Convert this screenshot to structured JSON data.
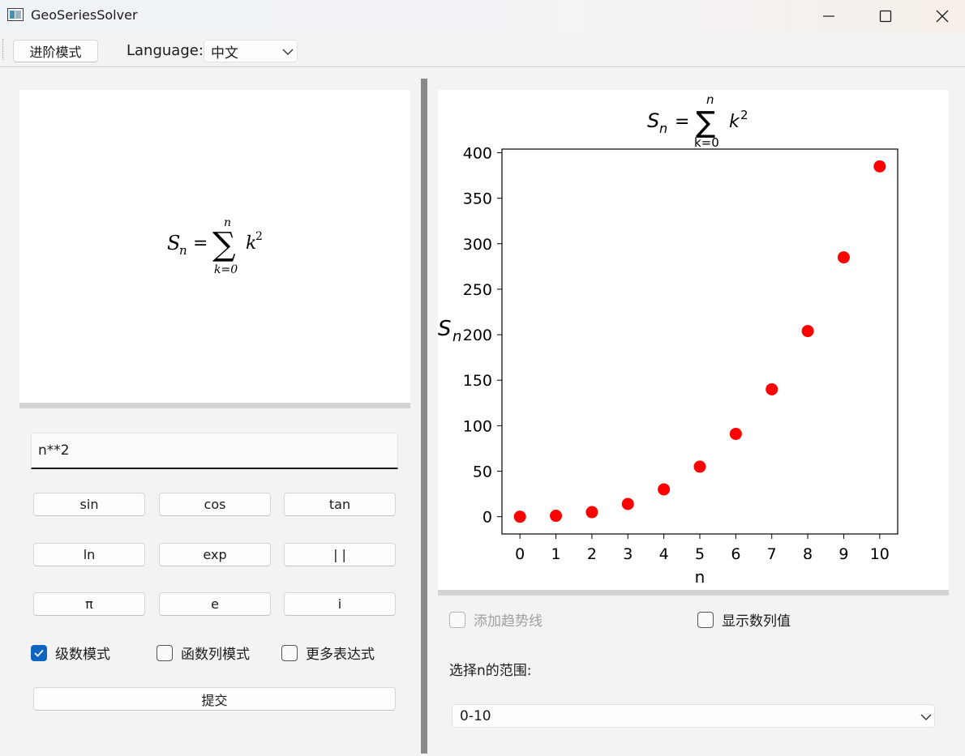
{
  "window": {
    "title": "GeoSeriesSolver",
    "minimize_icon": "minimize-icon",
    "maximize_icon": "maximize-icon",
    "close_icon": "close-icon"
  },
  "toolbar": {
    "advanced_mode_label": "进阶模式",
    "language_label": "Language:",
    "language_value": "中文"
  },
  "formula_preview": {
    "lhs": "S",
    "lhs_sub": "n",
    "equals": "=",
    "upper": "n",
    "lower": "k=0",
    "term": "k",
    "exponent": "2"
  },
  "expression_input": {
    "value": "n**2"
  },
  "keypad": {
    "row1": [
      "sin",
      "cos",
      "tan"
    ],
    "row2": [
      "ln",
      "exp",
      "| |"
    ],
    "row3": [
      "π",
      "e",
      "i"
    ]
  },
  "modes": {
    "series_mode": {
      "label": "级数模式",
      "checked": true
    },
    "function_sequence_mode": {
      "label": "函数列模式",
      "checked": false
    },
    "more_expressions": {
      "label": "更多表达式",
      "checked": false
    }
  },
  "submit_label": "提交",
  "options": {
    "trendline": {
      "label": "添加趋势线",
      "checked": false,
      "enabled": false
    },
    "show_values": {
      "label": "显示数列值",
      "checked": false
    }
  },
  "range": {
    "label": "选择n的范围:",
    "value": "0-10"
  },
  "colors": {
    "marker": "#ff0000",
    "checkbox_accent": "#0f64c0",
    "splitter": "#8a8a8a"
  },
  "chart_data": {
    "type": "scatter",
    "title": "S_n = Σ_{k=0}^{n} k^2",
    "xlabel": "n",
    "ylabel": "S_n",
    "x": [
      0,
      1,
      2,
      3,
      4,
      5,
      6,
      7,
      8,
      9,
      10
    ],
    "y": [
      0,
      1,
      5,
      14,
      30,
      55,
      91,
      140,
      204,
      285,
      385
    ],
    "xlim": [
      -0.5,
      10.5
    ],
    "ylim": [
      -19,
      404
    ],
    "xticks": [
      "0",
      "1",
      "2",
      "3",
      "4",
      "5",
      "6",
      "7",
      "8",
      "9",
      "10"
    ],
    "yticks": [
      "0",
      "50",
      "100",
      "150",
      "200",
      "250",
      "300",
      "350",
      "400"
    ],
    "grid": false,
    "legend": "none"
  }
}
